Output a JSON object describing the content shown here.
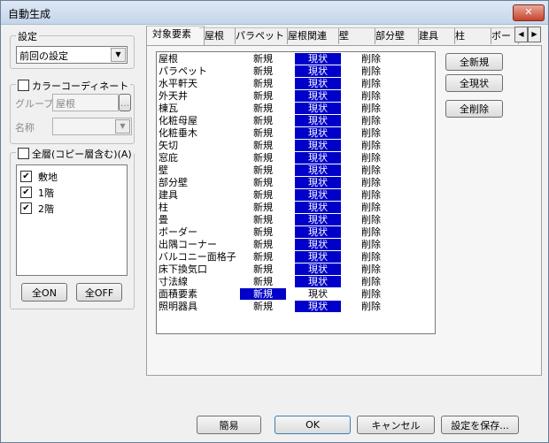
{
  "window": {
    "title": "自動生成",
    "close_label": "✕"
  },
  "settings_group": {
    "legend": "設定",
    "preset_value": "前回の設定"
  },
  "color_group": {
    "checkbox_label": "カラーコーディネート",
    "group_label": "グループ",
    "group_value": "屋根",
    "browse_label": "...",
    "name_label": "名称",
    "name_value": ""
  },
  "layers": {
    "checkbox_label": "全層(コピー層含む)(A)",
    "items": [
      {
        "label": "敷地",
        "checked": true
      },
      {
        "label": "1階",
        "checked": true
      },
      {
        "label": "2階",
        "checked": true
      }
    ],
    "all_on_label": "全ON",
    "all_off_label": "全OFF"
  },
  "tabs": [
    "対象要素",
    "屋根",
    "パラペット",
    "屋根関連",
    "壁",
    "部分壁",
    "建具",
    "柱",
    "ボー"
  ],
  "active_tab": 0,
  "tab_scroll": {
    "left": "◀",
    "right": "▶"
  },
  "elements": [
    {
      "name": "屋根",
      "sel": 2
    },
    {
      "name": "パラペット",
      "sel": 2
    },
    {
      "name": "水平軒天",
      "sel": 2
    },
    {
      "name": "外天井",
      "sel": 2
    },
    {
      "name": "棟瓦",
      "sel": 2
    },
    {
      "name": "化粧母屋",
      "sel": 2
    },
    {
      "name": "化粧垂木",
      "sel": 2
    },
    {
      "name": "矢切",
      "sel": 2
    },
    {
      "name": "窓庇",
      "sel": 2
    },
    {
      "name": "壁",
      "sel": 2
    },
    {
      "name": "部分壁",
      "sel": 2
    },
    {
      "name": "建具",
      "sel": 2
    },
    {
      "name": "柱",
      "sel": 2
    },
    {
      "name": "畳",
      "sel": 2
    },
    {
      "name": "ボーダー",
      "sel": 2
    },
    {
      "name": "出隅コーナー",
      "sel": 2
    },
    {
      "name": "バルコニー面格子",
      "sel": 2
    },
    {
      "name": "床下換気口",
      "sel": 2
    },
    {
      "name": "寸法線",
      "sel": 2
    },
    {
      "name": "面積要素",
      "sel": 1
    },
    {
      "name": "照明器具",
      "sel": 2
    }
  ],
  "option_labels": {
    "new": "新規",
    "current": "現状",
    "delete": "削除"
  },
  "side_buttons": {
    "all_new": "全新規",
    "all_current": "全現状",
    "all_delete": "全削除"
  },
  "footer": {
    "simple": "簡易",
    "ok": "OK",
    "cancel": "キャンセル",
    "save": "設定を保存..."
  },
  "colors": {
    "selection": "#0000c8"
  }
}
